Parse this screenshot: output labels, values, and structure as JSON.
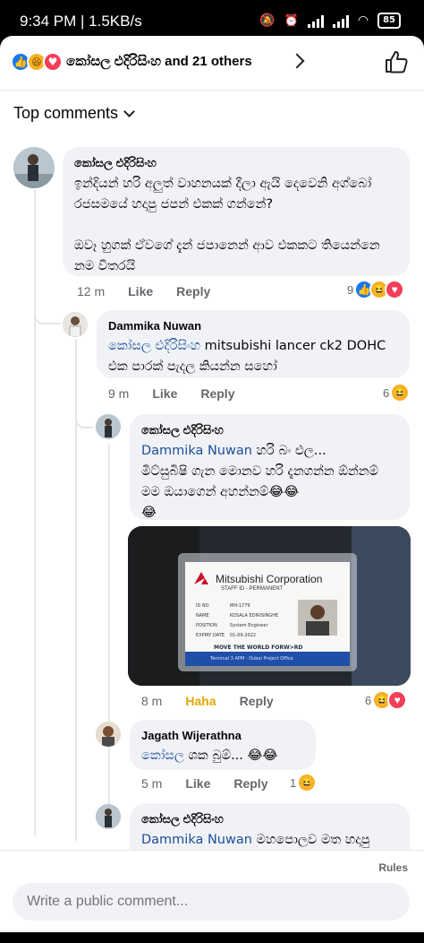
{
  "status_bar": {
    "time": "9:34 PM | 1.5KB/s",
    "battery": "85"
  },
  "reactions_header": {
    "reactors_text": "කෝසල එදිරිසිංහ and 21 others"
  },
  "top_comments_label": "Top comments",
  "comments": [
    {
      "author": "කෝසල එදිරිසිංහ",
      "text": "ඉන්දියන් හරි අලුත් වාහනයක් දීලා ඇයි දෙවෙනි අග්බෝ රජසමයේ හදාපු ජපන් එකක් ගන්නේ?\n\nඔවෑ හුගක් ඒවගේ දැන් ජපානෙන් ආව එකකට තියෙන්නෙ නම විතරයි",
      "time": "12 m",
      "like": "Like",
      "reply": "Reply",
      "reaction_count": "9"
    },
    {
      "author": "Dammika Nuwan",
      "mention": "කෝසල එදිරිසිංහ",
      "text": " mitsubishi lancer ck2 DOHC එක පාරක් පැදල කියන්න සහෝ",
      "time": "9 m",
      "like": "Like",
      "reply": "Reply",
      "reaction_count": "6"
    },
    {
      "author": "කෝසල එදිරිසිංහ",
      "mention": "Dammika Nuwan",
      "text": " හරි බං එල...\nමිට්සුබිෂි ගැන මොනව හරි දැනගන්න ඕන්නම් මම ඔයාගෙන් අහන්නම්😂😂\n😂",
      "time": "8 m",
      "like": "Haha",
      "reply": "Reply",
      "reaction_count": "6"
    },
    {
      "author": "Jagath Wijerathna",
      "mention": "කෝසල",
      "text": " ශක බුම්... 😂😂",
      "time": "5 m",
      "like": "Like",
      "reply": "Reply",
      "reaction_count": "1"
    },
    {
      "author": "කෝසල එදිරිසිංහ",
      "mention": "Dammika Nuwan",
      "text": " මහපොලව මත හදාපු"
    }
  ],
  "id_card": {
    "company": "Mitsubishi Corporation",
    "dept": "STAFF ID - PERMANENT",
    "no_label": "ID NO",
    "no_value": "MH-1779",
    "name_label": "NAME",
    "name_value": "KOSALA EDIRISINGHE",
    "position_label": "POSITION",
    "position_value": "System Engineer",
    "expiry_label": "EXPIRY DATE",
    "expiry_value": "01-09-2022",
    "slogan": "MOVE THE WORLD FORW>RD",
    "footer": "Terminal 3 APM - Dubai Project Office"
  },
  "bottom": {
    "rules": "Rules",
    "input_placeholder": "Write a public comment..."
  }
}
